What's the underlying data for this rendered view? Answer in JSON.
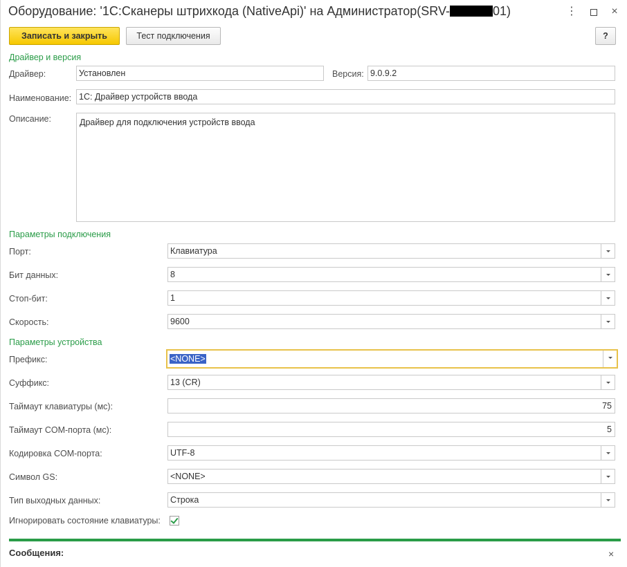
{
  "window": {
    "title_prefix": "Оборудование: '1С:Сканеры штрихкода (NativeApi)' на Администратор(SRV-",
    "title_suffix": "01)",
    "more_icon": "kebab-icon",
    "maximize_icon": "maximize-icon",
    "close_icon": "close-icon",
    "close_glyph": "×",
    "more_glyph": "⋮"
  },
  "toolbar": {
    "save_close_label": "Записать и закрыть",
    "test_label": "Тест подключения",
    "help_label": "?"
  },
  "driver_section": {
    "title": "Драйвер и версия",
    "driver_label": "Драйвер:",
    "driver_value": "Установлен",
    "version_label": "Версия:",
    "version_value": "9.0.9.2",
    "name_label": "Наименование:",
    "name_value": "1С: Драйвер устройств ввода",
    "description_label": "Описание:",
    "description_value": "Драйвер для подключения устройств ввода"
  },
  "connection_section": {
    "title": "Параметры подключения",
    "port_label": "Порт:",
    "port_value": "Клавиатура",
    "databits_label": "Бит данных:",
    "databits_value": "8",
    "stopbits_label": "Стоп-бит:",
    "stopbits_value": "1",
    "speed_label": "Скорость:",
    "speed_value": "9600"
  },
  "device_section": {
    "title": "Параметры устройства",
    "prefix_label": "Префикс:",
    "prefix_value": "<NONE>",
    "suffix_label": "Суффикс:",
    "suffix_value": "13 (CR)",
    "kbd_timeout_label": "Таймаут клавиатуры (мс):",
    "kbd_timeout_value": "75",
    "com_timeout_label": "Таймаут COM-порта (мс):",
    "com_timeout_value": "5",
    "encoding_label": "Кодировка COM-порта:",
    "encoding_value": "UTF-8",
    "gs_label": "Символ GS:",
    "gs_value": "<NONE>",
    "output_label": "Тип выходных данных:",
    "output_value": "Строка",
    "ignore_kbd_label": "Игнорировать состояние клавиатуры:",
    "ignore_kbd_checked": true
  },
  "messages": {
    "title": "Сообщения:",
    "close_glyph": "×"
  },
  "colors": {
    "accent_green": "#2a9c48",
    "primary_button": "#f6c800",
    "focus_border": "#e8c24a",
    "selection": "#3a63c7"
  }
}
